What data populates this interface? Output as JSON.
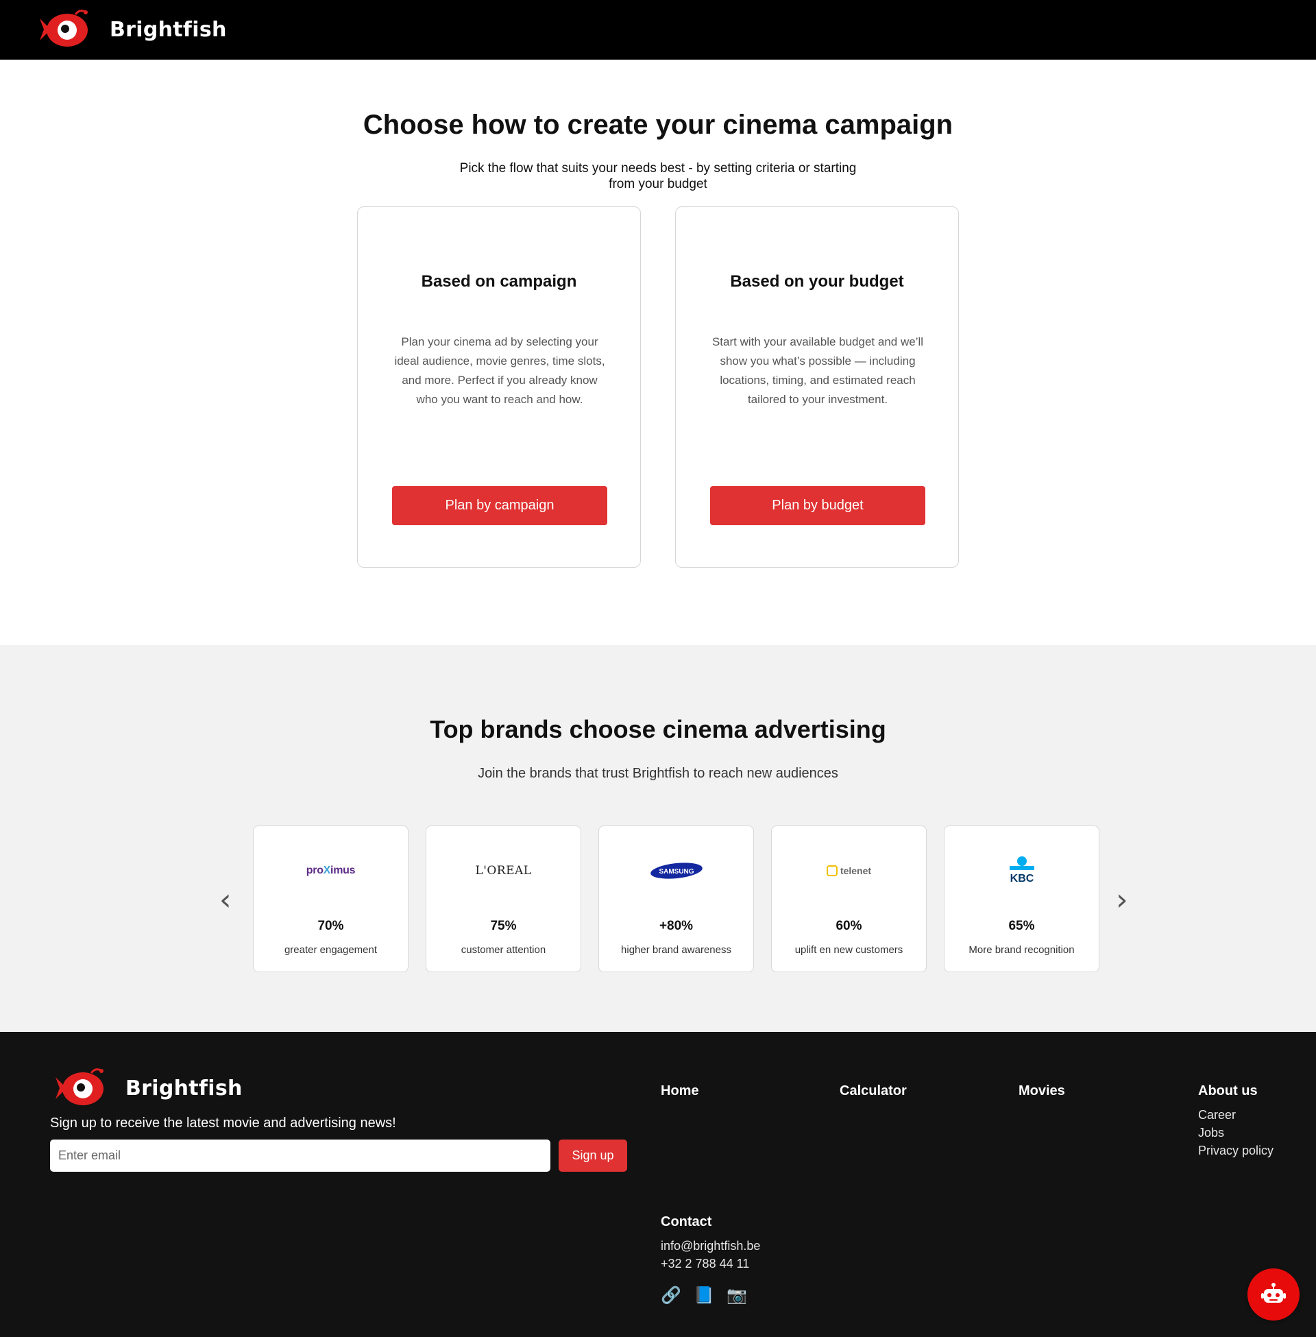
{
  "header": {
    "brand": "Brightfish"
  },
  "hero": {
    "title": "Choose how to create your cinema campaign",
    "subtitle": "Pick the flow that suits your needs best - by setting criteria or starting from your budget"
  },
  "flows": [
    {
      "title": "Based on campaign",
      "description": "Plan your cinema ad by selecting your ideal audience, movie genres, time slots, and more. Perfect if you already know who you want to reach and how.",
      "button": "Plan by campaign"
    },
    {
      "title": "Based on your budget",
      "description": "Start with your available budget and we’ll show you what’s possible — including locations, timing, and estimated reach tailored to your investment.",
      "button": "Plan by budget"
    }
  ],
  "brands": {
    "title": "Top brands choose cinema advertising",
    "subtitle": "Join the brands that trust Brightfish to reach new audiences",
    "prev_arrow": "‹",
    "next_arrow": "›",
    "items": [
      {
        "logo": "proximus",
        "logo_text_a": "pro",
        "logo_text_x": "X",
        "logo_text_b": "imus",
        "stat": "70%",
        "desc": "greater engagement"
      },
      {
        "logo": "loreal",
        "logo_text": "L'OREAL",
        "stat": "75%",
        "desc": "customer attention"
      },
      {
        "logo": "samsung",
        "logo_text": "SAMSUNG",
        "stat": "+80%",
        "desc": "higher brand awareness"
      },
      {
        "logo": "telenet",
        "logo_text": "telenet",
        "stat": "60%",
        "desc": "uplift en new customers"
      },
      {
        "logo": "kbc",
        "logo_text": "KBC",
        "stat": "65%",
        "desc": "More brand recognition"
      }
    ]
  },
  "footer": {
    "brand": "Brightfish",
    "signup_text": "Sign up to receive the latest movie and advertising news!",
    "email_placeholder": "Enter email",
    "signup_button": "Sign up",
    "nav": {
      "home": "Home",
      "calculator": "Calculator",
      "movies": "Movies",
      "about": "About us",
      "about_links": [
        "Career",
        "Jobs",
        "Privacy policy"
      ]
    },
    "contact": {
      "heading": "Contact",
      "email": "info@brightfish.be",
      "phone": "+32 2 788 44 11"
    },
    "social_icons": [
      "link-icon",
      "book-icon",
      "camera-icon"
    ],
    "social_glyphs": [
      "🔗",
      "📘",
      "📷"
    ]
  },
  "colors": {
    "accent": "#e03232",
    "header_bg": "#000000",
    "footer_bg": "#121212",
    "brands_bg": "#f2f2f2"
  }
}
